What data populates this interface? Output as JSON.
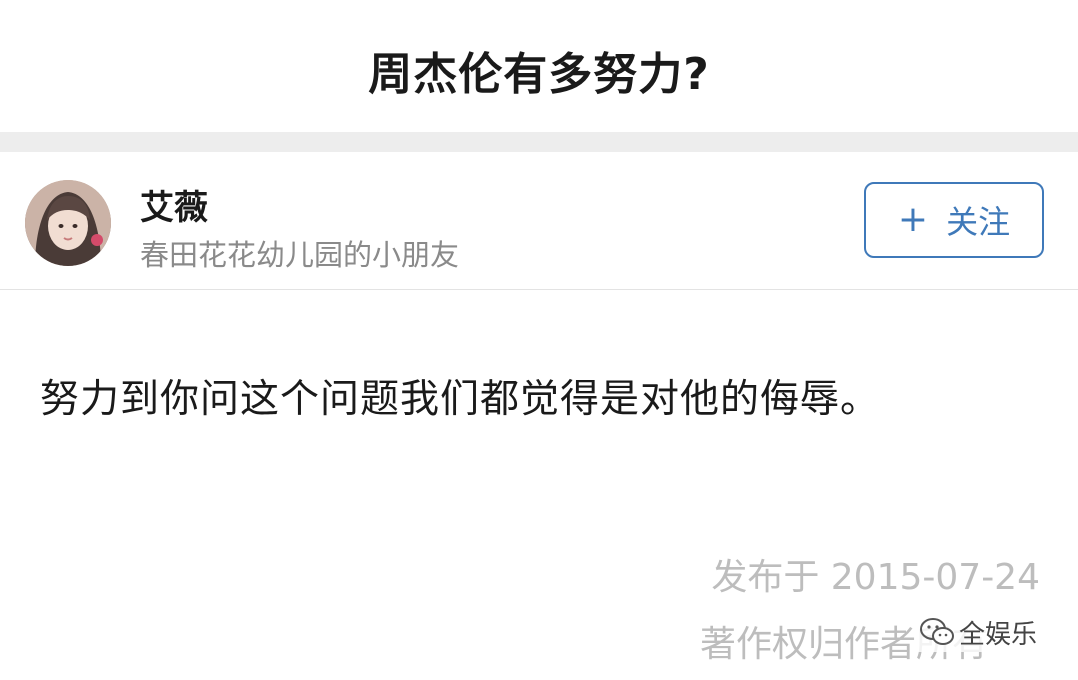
{
  "question": {
    "title": "周杰伦有多努力?"
  },
  "author": {
    "name": "艾薇",
    "bio": "春田花花幼儿园的小朋友",
    "avatar_icon": "avatar-photo"
  },
  "follow": {
    "plus_icon": "+",
    "label": "关注",
    "color": "#3f79b9"
  },
  "answer": {
    "text": "努力到你问这个问题我们都觉得是对他的侮辱。"
  },
  "footer": {
    "published": "发布于 2015-07-24",
    "copyright": "著作权归作者所有"
  },
  "watermark": {
    "icon": "wechat-icon",
    "text": "全娱乐"
  }
}
